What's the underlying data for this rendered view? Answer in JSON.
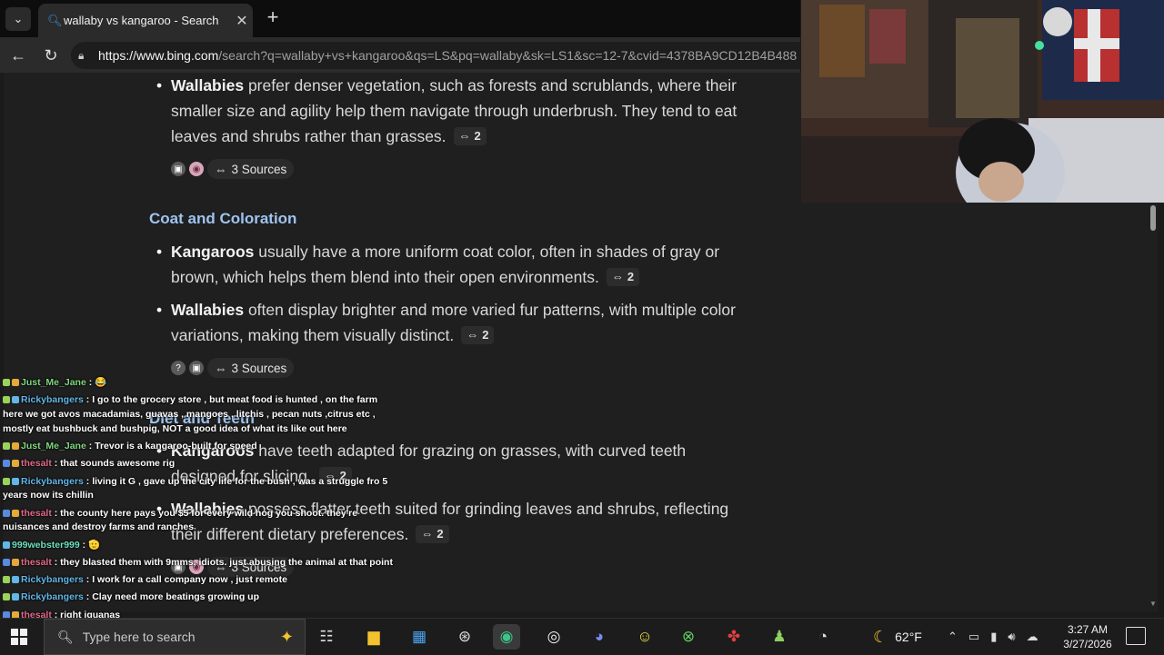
{
  "browser": {
    "tab_title": "wallaby vs kangaroo - Search",
    "url_host": "https://www.bing.com",
    "url_rest": "/search?q=wallaby+vs+kangaroo&qs=LS&pq=wallaby&sk=LS1&sc=12-7&cvid=4378BA9CD12B4B488"
  },
  "content": {
    "habitat_wallabies_bold": "Wallabies",
    "habitat_wallabies_text": " prefer denser vegetation, such as forests and scrublands, where their smaller size and agility help them navigate through underbrush. They tend to eat leaves and shrubs rather than grasses.",
    "habitat_cite": "2",
    "sources_label": "3 Sources",
    "coat_heading": "Coat and Coloration",
    "coat_kangaroos_bold": "Kangaroos",
    "coat_kangaroos_text": " usually have a more uniform coat color, often in shades of gray or brown, which helps them blend into their open environments.",
    "coat_kangaroos_cite": "2",
    "coat_wallabies_bold": "Wallabies",
    "coat_wallabies_text": " often display brighter and more varied fur patterns, with multiple color variations, making them visually distinct.",
    "coat_wallabies_cite": "2",
    "teeth_heading": "Diet and Teeth",
    "teeth_kangaroos_bold": "Kangaroos",
    "teeth_kangaroos_text": " have teeth adapted for grazing on grasses, with curved teeth designed for slicing.",
    "teeth_kangaroos_cite": "2",
    "teeth_wallabies_bold": "Wallabies",
    "teeth_wallabies_text": " possess flatter teeth suited for grinding leaves and shrubs, reflecting their different dietary preferences.",
    "teeth_wallabies_cite": "2"
  },
  "chat": [
    {
      "user": "Just_Me_Jane",
      "color": "#7fd67f",
      "text": " : 😂"
    },
    {
      "user": "Rickybangers",
      "color": "#62b6e8",
      "text": " : I go to the grocery store , but meat food is hunted , on the farm here we got avos macadamias, guavas , mangoes , litchis , pecan nuts ,citrus etc , mostly eat bushbuck and bushpig, NOT a good idea of what its like out here"
    },
    {
      "user": "Just_Me_Jane",
      "color": "#7fd67f",
      "text": " : Trevor is a kangaroo-built for speed"
    },
    {
      "user": "thesalt",
      "color": "#e06a8a",
      "text": " : that sounds awesome rig"
    },
    {
      "user": "Rickybangers",
      "color": "#62b6e8",
      "text": " : living it G , gave up the city life for the bush , was a struggle fro 5 years now its chillin"
    },
    {
      "user": "thesalt",
      "color": "#e06a8a",
      "text": " : the county here pays you $5 for every wild hog you shoot. they're nuisances and destroy farms and ranches"
    },
    {
      "user": "999webster999",
      "color": "#6fe0c0",
      "text": " : 🫡"
    },
    {
      "user": "thesalt",
      "color": "#e06a8a",
      "text": " : they blasted them with 9mms, idiots. just abusing the animal at that point"
    },
    {
      "user": "Rickybangers",
      "color": "#62b6e8",
      "text": " : I work for a call company now , just remote"
    },
    {
      "user": "Rickybangers",
      "color": "#62b6e8",
      "text": " : Clay need more beatings growing up"
    },
    {
      "user": "thesalt",
      "color": "#e06a8a",
      "text": " : right iguanas"
    }
  ],
  "taskbar": {
    "search_placeholder": "Type here to search",
    "weather": "62°F",
    "time": "3:27 AM",
    "date": "3/27/2026"
  }
}
